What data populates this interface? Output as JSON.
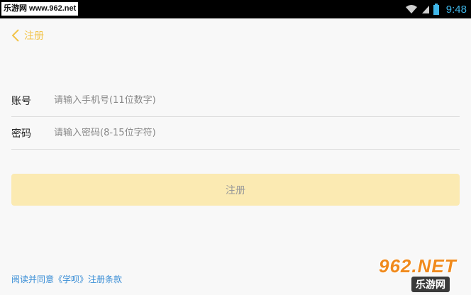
{
  "status_bar": {
    "watermark": "乐游网 www.962.net",
    "time": "9:48"
  },
  "header": {
    "title": "注册"
  },
  "form": {
    "account_label": "账号",
    "account_placeholder": "请输入手机号(11位数字)",
    "password_label": "密码",
    "password_placeholder": "请输入密码(8-15位字符)"
  },
  "register_button": "注册",
  "terms_text": "阅读并同意《学呗》注册条款",
  "watermark": {
    "top": "962.NET",
    "bottom": "乐游网"
  },
  "colors": {
    "accent": "#f2c44a",
    "button_bg": "#fbeab2",
    "link": "#3a8ed6",
    "time": "#3fb6e8"
  }
}
